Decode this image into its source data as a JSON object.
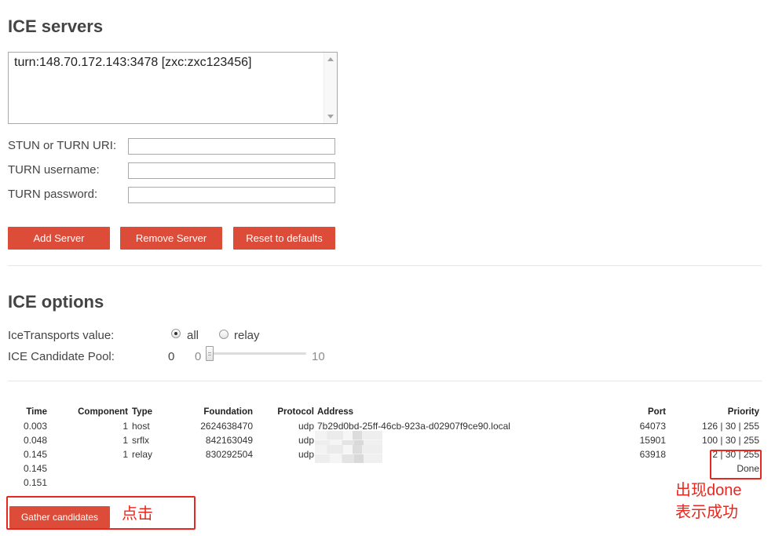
{
  "colors": {
    "accent": "#dd4b39",
    "annotation": "#e8281e"
  },
  "ice_servers": {
    "title": "ICE servers",
    "servers": [
      "turn:148.70.172.143:3478 [zxc:zxc123456]"
    ],
    "uri_label": "STUN or TURN URI:",
    "username_label": "TURN username:",
    "password_label": "TURN password:",
    "add_label": "Add Server",
    "remove_label": "Remove Server",
    "reset_label": "Reset to defaults"
  },
  "ice_options": {
    "title": "ICE options",
    "transports_label": "IceTransports value:",
    "transports": [
      {
        "label": "all",
        "checked": true
      },
      {
        "label": "relay",
        "checked": false
      }
    ],
    "pool": {
      "label": "ICE Candidate Pool:",
      "value": 0,
      "min": 0,
      "max": 10
    }
  },
  "candidates": {
    "headers": {
      "time": "Time",
      "component": "Component",
      "type": "Type",
      "foundation": "Foundation",
      "protocol": "Protocol",
      "address": "Address",
      "port": "Port",
      "priority": "Priority"
    },
    "rows": [
      {
        "time": "0.003",
        "component": "1",
        "type": "host",
        "foundation": "2624638470",
        "protocol": "udp",
        "address": "7b29d0bd-25ff-46cb-923a-d02907f9ce90.local",
        "port": "64073",
        "priority": "126 | 30 | 255"
      },
      {
        "time": "0.048",
        "component": "1",
        "type": "srflx",
        "foundation": "842163049",
        "protocol": "udp",
        "address_obscured": true,
        "port": "15901",
        "priority": "100 | 30 | 255"
      },
      {
        "time": "0.145",
        "component": "1",
        "type": "relay",
        "foundation": "830292504",
        "protocol": "udp",
        "address_obscured": true,
        "port": "63918",
        "priority": "2 | 30 | 255"
      },
      {
        "time": "0.145",
        "priority": "Done"
      },
      {
        "time": "0.151"
      }
    ]
  },
  "gather_label": "Gather candidates",
  "annotations": {
    "click_note": "点击",
    "done_note": [
      "出现done",
      "表示成功"
    ]
  }
}
